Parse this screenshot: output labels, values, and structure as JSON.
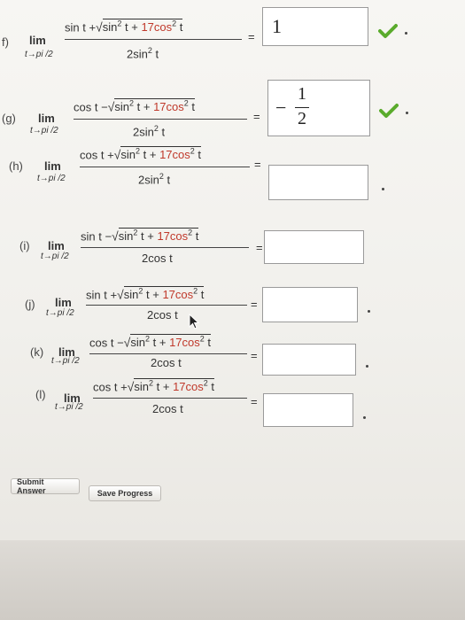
{
  "problems": [
    {
      "label": "f)",
      "lim": "lim",
      "sub": "t→pi /2",
      "num": {
        "lead": "sin t +",
        "rad_a": "sin",
        "rad_a_sup": "2",
        "rad_b": "t + ",
        "rad_c": "17cos",
        "rad_c_sup": "2",
        "rad_d": "t"
      },
      "den": {
        "text": "2sin",
        "sup": "2",
        "tail": "t"
      },
      "answer": "1",
      "status": "correct"
    },
    {
      "label": "(g)",
      "lim": "lim",
      "sub": "t→pi /2",
      "num": {
        "lead": "cos t −",
        "rad_a": "sin",
        "rad_a_sup": "2",
        "rad_b": "t + ",
        "rad_c": "17cos",
        "rad_c_sup": "2",
        "rad_d": "t"
      },
      "den": {
        "text": "2sin",
        "sup": "2",
        "tail": "t"
      },
      "answer_sign": "−",
      "answer_num": "1",
      "answer_den": "2",
      "status": "correct"
    },
    {
      "label": "(h)",
      "lim": "lim",
      "sub": "t→pi /2",
      "num": {
        "lead": "cos t +",
        "rad_a": "sin",
        "rad_a_sup": "2",
        "rad_b": "t + ",
        "rad_c": "17cos",
        "rad_c_sup": "2",
        "rad_d": "t"
      },
      "den": {
        "text": "2sin",
        "sup": "2",
        "tail": "t"
      },
      "answer": ""
    },
    {
      "label": "(i)",
      "lim": "lim",
      "sub": "t→pi /2",
      "num": {
        "lead": "sin t −",
        "rad_a": "sin",
        "rad_a_sup": "2",
        "rad_b": "t + ",
        "rad_c": "17cos",
        "rad_c_sup": "2",
        "rad_d": "t"
      },
      "den": {
        "text": "2cos t",
        "sup": "",
        "tail": ""
      },
      "answer": ""
    },
    {
      "label": "(j)",
      "lim": "lim",
      "sub": "t→pi /2",
      "num": {
        "lead": "sin t +",
        "rad_a": "sin",
        "rad_a_sup": "2",
        "rad_b": "t + ",
        "rad_c": "17cos",
        "rad_c_sup": "2",
        "rad_d": "t"
      },
      "den": {
        "text": "2cos t",
        "sup": "",
        "tail": ""
      },
      "answer": ""
    },
    {
      "label": "(k)",
      "lim": "lim",
      "sub": "t→pi /2",
      "num": {
        "lead": "cos t −",
        "rad_a": "sin",
        "rad_a_sup": "2",
        "rad_b": "t + ",
        "rad_c": "17cos",
        "rad_c_sup": "2",
        "rad_d": "t"
      },
      "den": {
        "text": "2cos t",
        "sup": "",
        "tail": ""
      },
      "answer": ""
    },
    {
      "label": "(l)",
      "lim": "lim",
      "sub": "t→pi /2",
      "num": {
        "lead": "cos t +",
        "rad_a": "sin",
        "rad_a_sup": "2",
        "rad_b": "t + ",
        "rad_c": "17cos",
        "rad_c_sup": "2",
        "rad_d": "t"
      },
      "den": {
        "text": "2cos t",
        "sup": "",
        "tail": ""
      },
      "answer": ""
    }
  ],
  "eq_sign": "=",
  "buttons": {
    "submit": "Submit Answer",
    "save": "Save Progress"
  },
  "colors": {
    "check": "#5aab2c",
    "coefficient": "#c0392b"
  }
}
